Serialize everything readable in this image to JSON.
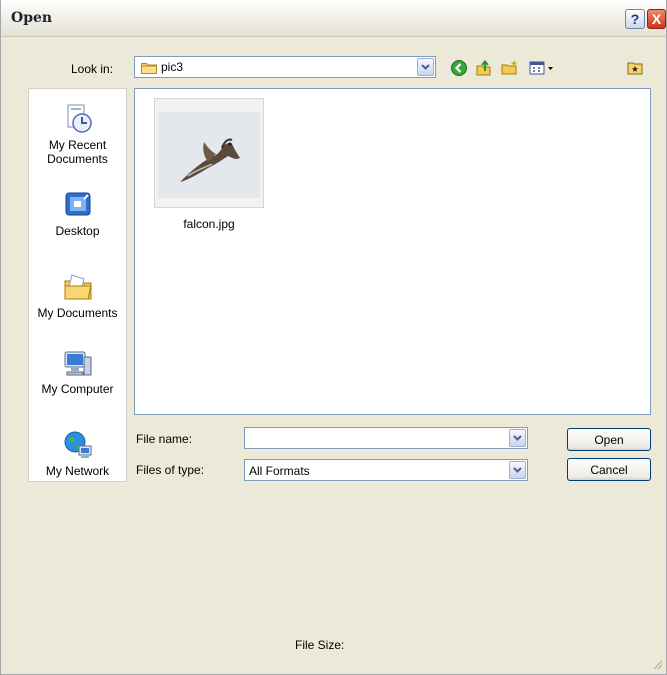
{
  "window": {
    "title": "Open"
  },
  "titlebar": {
    "help_glyph": "?",
    "close_glyph": "X"
  },
  "lookin": {
    "label": "Look in:",
    "value": "pic3",
    "icon": "folder-icon"
  },
  "toolbar": {
    "icons": [
      "back-icon",
      "up-folder-icon",
      "new-folder-icon",
      "views-menu-icon",
      "desktop-shortcut-icon"
    ]
  },
  "places": {
    "items": [
      {
        "label": "My Recent Documents",
        "icon": "recent-documents-icon"
      },
      {
        "label": "Desktop",
        "icon": "desktop-icon"
      },
      {
        "label": "My Documents",
        "icon": "my-documents-icon"
      },
      {
        "label": "My Computer",
        "icon": "my-computer-icon"
      },
      {
        "label": "My Network",
        "icon": "my-network-icon"
      }
    ]
  },
  "files": [
    {
      "name": "falcon.jpg"
    }
  ],
  "form": {
    "file_name_label": "File name:",
    "file_name_value": "",
    "files_of_type_label": "Files of type:",
    "files_of_type_value": "All Formats"
  },
  "buttons": {
    "open": "Open",
    "cancel": "Cancel"
  },
  "status": {
    "file_size_label": "File Size:"
  },
  "colors": {
    "dialog_bg": "#ece9d8",
    "field_border": "#7f9db9",
    "button_border": "#003c74"
  }
}
